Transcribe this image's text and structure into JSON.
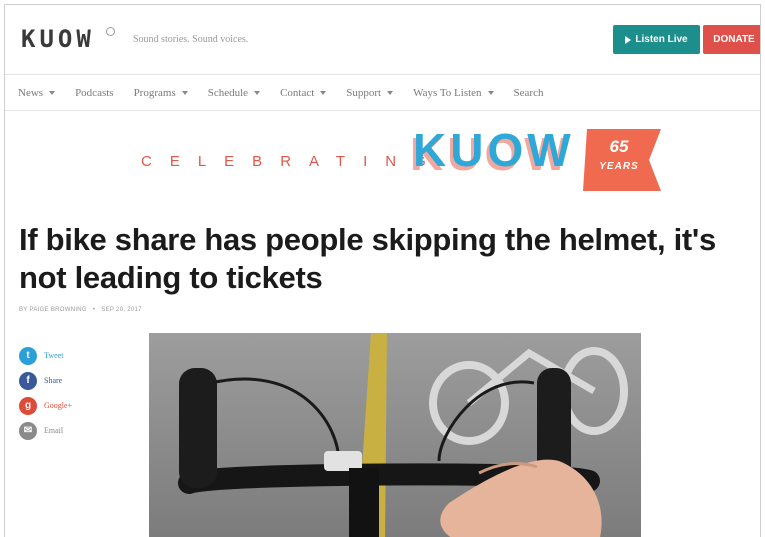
{
  "header": {
    "logo": "KUOW",
    "tagline": "Sound stories. Sound voices.",
    "listen_live": "Listen Live",
    "donate": "DONATE"
  },
  "nav": {
    "items": [
      {
        "label": "News",
        "dropdown": true
      },
      {
        "label": "Podcasts",
        "dropdown": false
      },
      {
        "label": "Programs",
        "dropdown": true
      },
      {
        "label": "Schedule",
        "dropdown": true
      },
      {
        "label": "Contact",
        "dropdown": true
      },
      {
        "label": "Support",
        "dropdown": true
      },
      {
        "label": "Ways To Listen",
        "dropdown": true
      },
      {
        "label": "Search",
        "dropdown": false
      }
    ]
  },
  "banner": {
    "celebrating": "CELEBRATING",
    "station": "KUOW",
    "anniversary_number": "65",
    "anniversary_word": "YEARS"
  },
  "article": {
    "headline": "If bike share has people skipping the helmet, it's not leading to tickets",
    "byline_author": "BY PAIGE BROWNING",
    "byline_date": "SEP 20, 2017"
  },
  "share": [
    {
      "label": "Tweet",
      "icon": "twitter-icon",
      "glyph": "t",
      "color": "#2a9fd8"
    },
    {
      "label": "Share",
      "icon": "facebook-icon",
      "glyph": "f",
      "color": "#3b5998"
    },
    {
      "label": "Google+",
      "icon": "googleplus-icon",
      "glyph": "g",
      "color": "#dd4b39"
    },
    {
      "label": "Email",
      "icon": "email-icon",
      "glyph": "✉",
      "color": "#8a8a8a"
    }
  ],
  "colors": {
    "teal": "#1c8f8c",
    "red": "#e0504a",
    "banner_blue": "#2fa8d8",
    "banner_coral": "#f06a4f"
  }
}
